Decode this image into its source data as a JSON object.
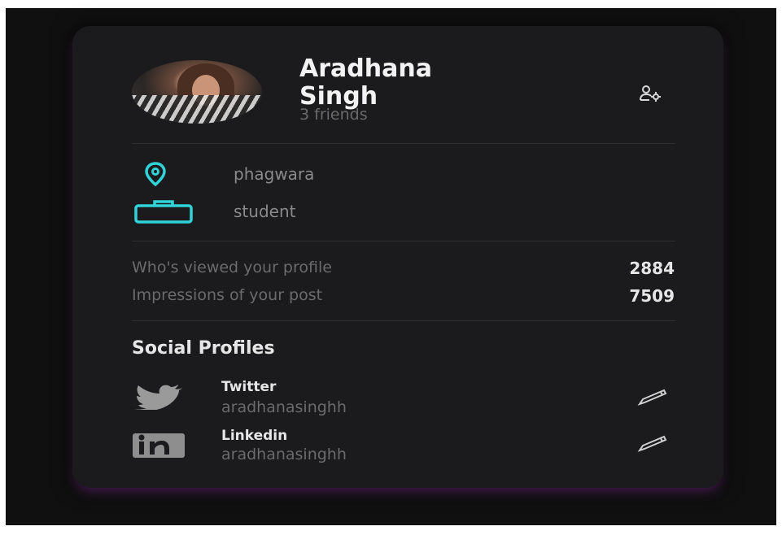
{
  "profile": {
    "first_name": "Aradhana",
    "last_name": "Singh",
    "friends": "3 friends",
    "avatar_icon": "profile-photo",
    "settings_icon": "user-settings-icon"
  },
  "info": {
    "location": "phagwara",
    "occupation": "student",
    "location_icon": "location-pin-icon",
    "occupation_icon": "briefcase-icon",
    "accent_color": "#2fd3d8"
  },
  "stats": [
    {
      "label": "Who's viewed your profile",
      "value": "2884"
    },
    {
      "label": "Impressions of your post",
      "value": "7509"
    }
  ],
  "social": {
    "title": "Social Profiles",
    "items": [
      {
        "name": "Twitter",
        "handle": "aradhanasinghh",
        "icon": "twitter-icon"
      },
      {
        "name": "Linkedin",
        "handle": "aradhanasinghh",
        "icon": "linkedin-icon"
      }
    ],
    "edit_icon": "pencil-icon"
  },
  "colors": {
    "background": "#101010",
    "card": "#1b1b1d",
    "card_glow": "#78288c"
  }
}
